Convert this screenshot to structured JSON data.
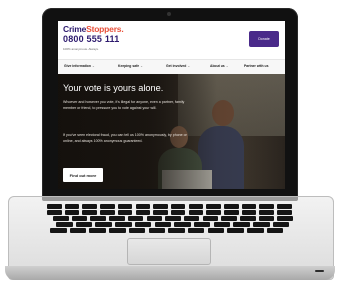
{
  "site": {
    "logo_part1": "Crime",
    "logo_part2": "Stoppers.",
    "phone": "0800 555 111",
    "tagline": "100% anonymous. Always.",
    "donate_label": "Donate"
  },
  "nav": {
    "items": [
      "Give information",
      "Keeping safe",
      "Get involved",
      "About us",
      "Partner with us"
    ]
  },
  "hero": {
    "title": "Your vote is yours alone.",
    "paragraph1": "Whoever and however you vote, it's illegal for anyone, even a partner, family member or friend, to pressure you to vote against your will.",
    "paragraph2": "If you've seen electoral fraud, you can tell us 100% anonymously, by phone or online, and always 100% anonymous guaranteed.",
    "cta_label": "Find out more"
  },
  "colors": {
    "brand_purple": "#2d1a6e",
    "brand_orange": "#e8503a",
    "donate_bg": "#4a2a8a"
  }
}
